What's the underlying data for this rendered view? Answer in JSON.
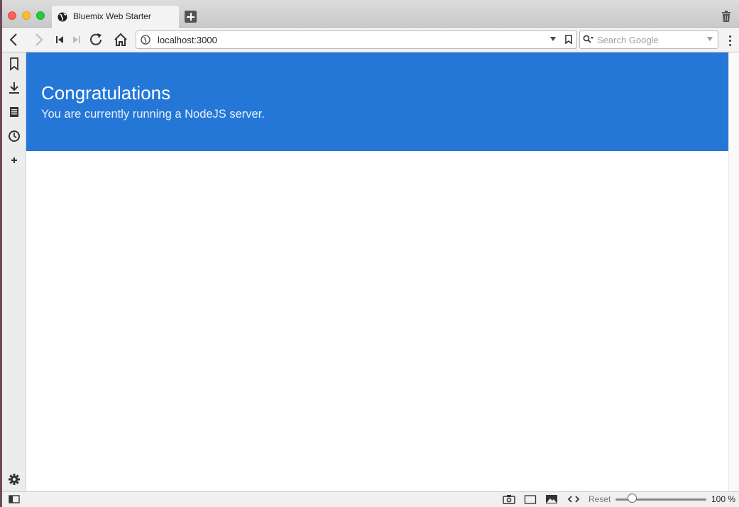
{
  "tab": {
    "title": "Bluemix Web Starter"
  },
  "address": {
    "url": "localhost:3000"
  },
  "search": {
    "placeholder": "Search Google"
  },
  "hero": {
    "title": "Congratulations",
    "subtitle": "You are currently running a NodeJS server."
  },
  "statusbar": {
    "reset_label": "Reset",
    "zoom_label": "100 %",
    "zoom_level": 1.0
  },
  "colors": {
    "hero_bg": "#2477d7",
    "tab_bg": "#f3f3f3"
  },
  "icons": {
    "sidebar": [
      "bookmark-icon",
      "download-icon",
      "notes-icon",
      "history-icon",
      "add-panel-icon",
      "settings-icon"
    ],
    "toolbar": [
      "back-icon",
      "forward-icon",
      "rewind-icon",
      "fast-forward-icon",
      "reload-icon",
      "home-icon"
    ],
    "statusbar": [
      "panel-toggle-icon",
      "capture-icon",
      "tiling-icon",
      "images-icon",
      "page-actions-icon"
    ]
  }
}
